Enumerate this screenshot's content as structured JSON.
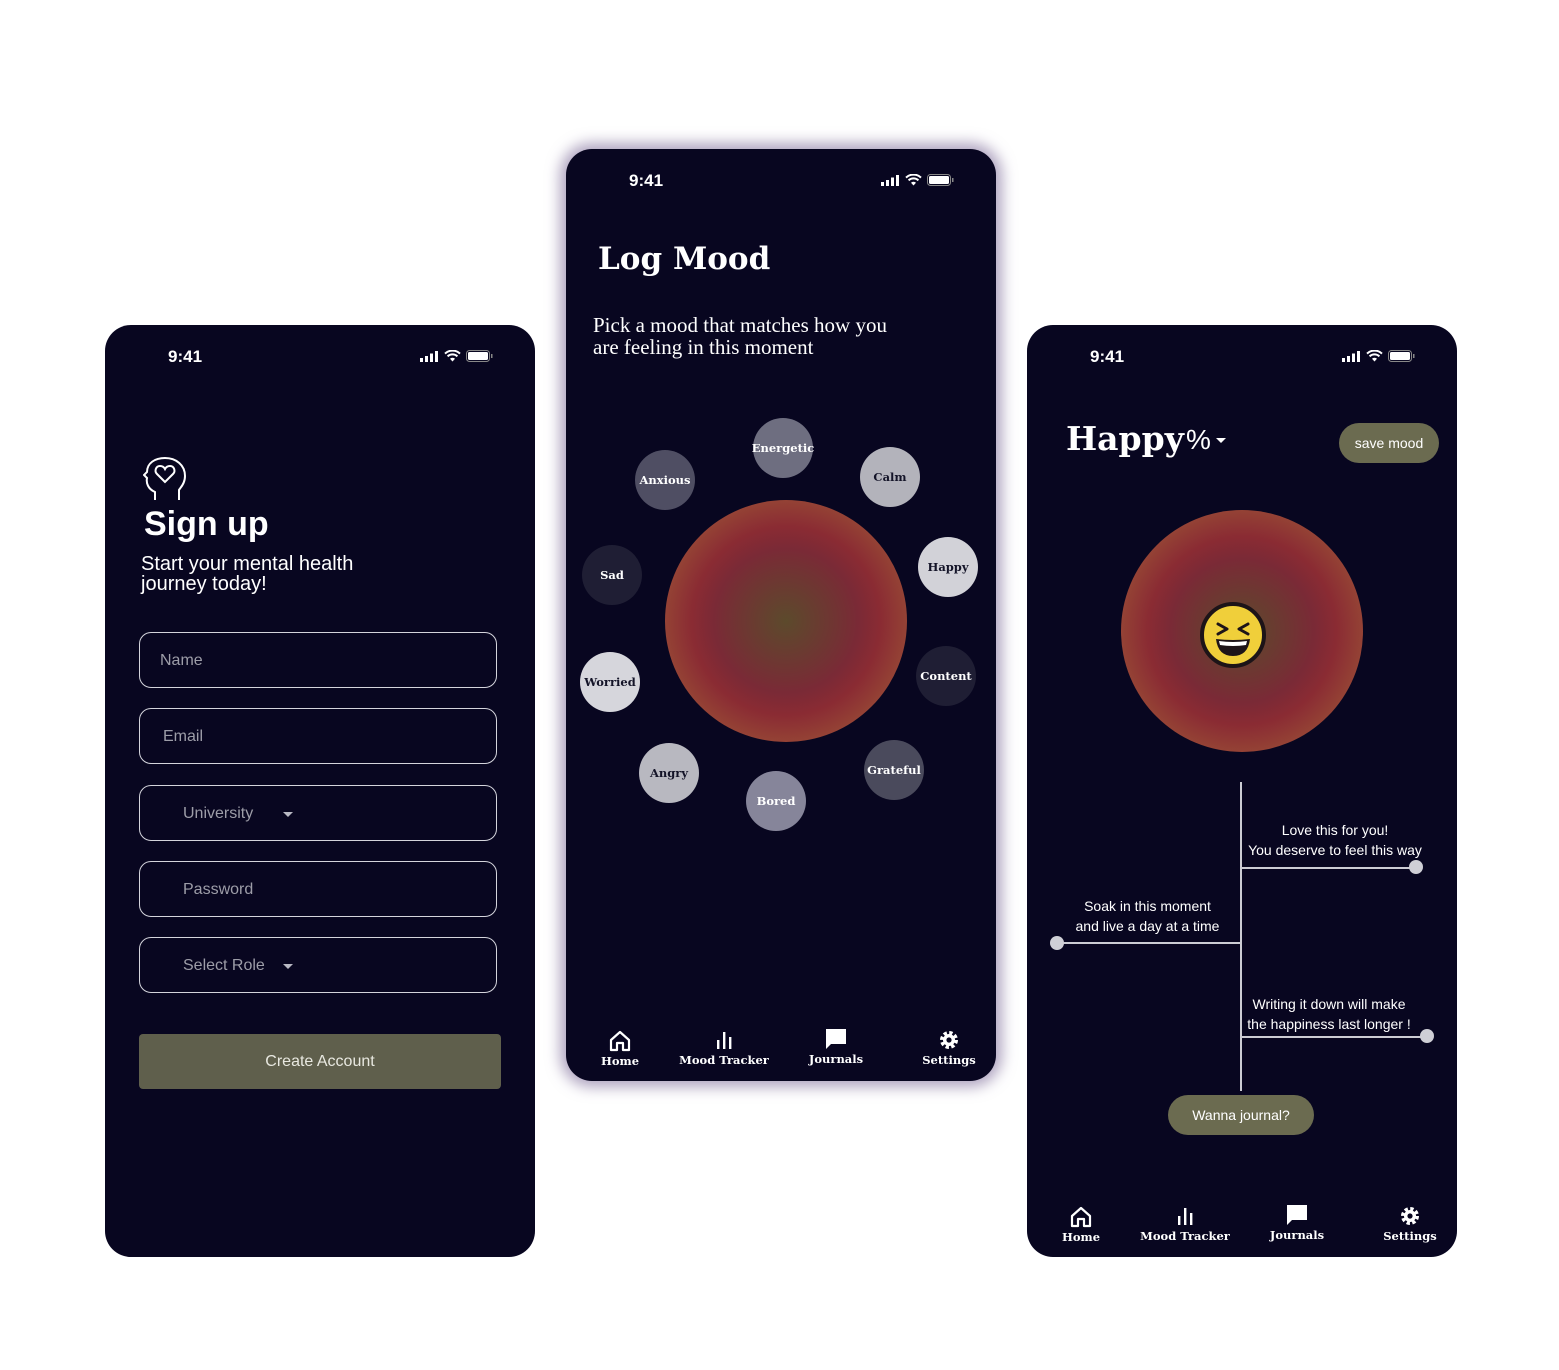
{
  "status_bar": {
    "time": "9:41"
  },
  "signup": {
    "title": "Sign up",
    "subtitle": "Start your mental health journey today!",
    "fields": {
      "name": "Name",
      "email": "Email",
      "university": "University",
      "password": "Password",
      "role": "Select Role"
    },
    "create_button": "Create Account"
  },
  "log_mood": {
    "title": "Log Mood",
    "subtitle": "Pick a mood that matches how you are feeling in this moment",
    "moods": {
      "energetic": "Energetic",
      "calm": "Calm",
      "anxious": "Anxious",
      "sad": "Sad",
      "happy": "Happy",
      "content": "Content",
      "worried": "Worried",
      "angry": "Angry",
      "bored": "Bored",
      "grateful": "Grateful"
    }
  },
  "nav": {
    "home": "Home",
    "mood_tracker": "Mood Tracker",
    "journals": "Journals",
    "settings": "Settings"
  },
  "happy": {
    "title": "Happy",
    "percent_symbol": "%",
    "save_button": "save mood",
    "messages": {
      "love_line1": "Love this for you!",
      "love_line2": "You deserve to feel this way",
      "soak_line1": "Soak in this moment",
      "soak_line2": "and live a day at a time",
      "write_line1": "Writing it down will make",
      "write_line2": "the happiness last longer !"
    },
    "journal_button": "Wanna journal?"
  },
  "colors": {
    "background": "#080620",
    "button_olive": "#6b6b50",
    "create_button": "#5f5f4c"
  }
}
